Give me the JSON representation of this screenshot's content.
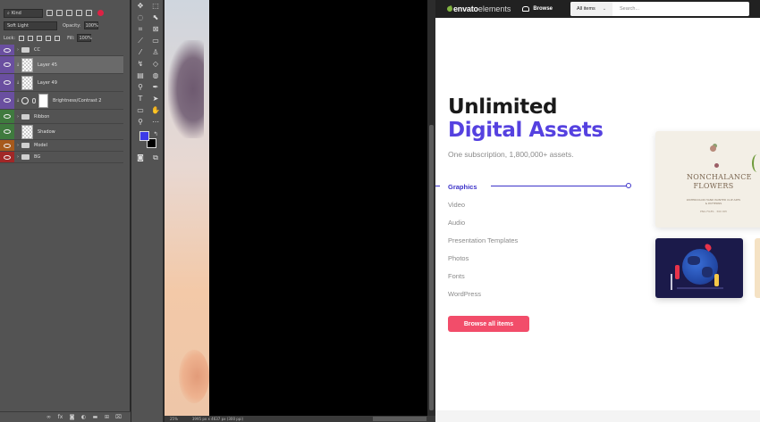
{
  "photoshop": {
    "layers_panel": {
      "filter_kind": "Kind",
      "blend_mode": "Soft Light",
      "opacity_label": "Opacity:",
      "opacity_value": "100%",
      "lock_label": "Lock:",
      "fill_label": "Fill:",
      "fill_value": "100%",
      "layers": [
        {
          "name": "CC",
          "type": "group",
          "tag_color": "purple"
        },
        {
          "name": "Layer 45",
          "type": "pixel",
          "tag_color": "purple",
          "selected": true
        },
        {
          "name": "Layer 49",
          "type": "pixel",
          "tag_color": "purple"
        },
        {
          "name": "Brightness/Contrast 2",
          "type": "adjustment",
          "tag_color": "purple"
        },
        {
          "name": "Ribbon",
          "type": "group",
          "tag_color": "green"
        },
        {
          "name": "Shadow",
          "type": "pixel",
          "tag_color": "green"
        },
        {
          "name": "Model",
          "type": "group",
          "tag_color": "orange"
        },
        {
          "name": "BG",
          "type": "group",
          "tag_color": "red"
        }
      ],
      "footer_icons": [
        "link-icon",
        "fx-icon",
        "mask-icon",
        "adjustment-icon",
        "folder-icon",
        "new-layer-icon",
        "trash-icon"
      ]
    },
    "toolbar": {
      "foreground_color": "#3d3ae8",
      "background_color": "#000000"
    },
    "status_bar": {
      "zoom": "25%",
      "doc_info": "3995 px x 4637 px (300 ppi)"
    }
  },
  "website": {
    "logo_bold": "envato",
    "logo_light": "elements",
    "nav_browse": "Browse",
    "search_category": "All items",
    "search_placeholder": "Search...",
    "hero_line1": "Unlimited",
    "hero_line2": "Digital Assets",
    "subtitle": "One subscription, 1,800,000+ assets.",
    "categories": [
      "Graphics",
      "Video",
      "Audio",
      "Presentation Templates",
      "Photos",
      "Fonts",
      "WordPress"
    ],
    "active_category": "Graphics",
    "cta": "Browse all items",
    "card1_title": "NONCHALANCE FLOWERS",
    "card1_subtitle": "WATERCOLOR HAND PAINTED CLIP ARTS & PATTERNS",
    "card1_files": "PNG FILES · 300 DPI",
    "accent_color": "#5541e0",
    "cta_color": "#f24d6a"
  }
}
